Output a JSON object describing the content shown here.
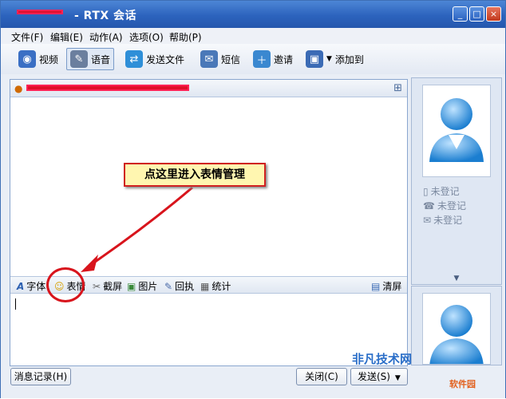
{
  "window": {
    "title": "- RTX 会话",
    "btn_min": "_",
    "btn_max": "□",
    "btn_close": "×"
  },
  "menu": [
    "文件(F)",
    "编辑(E)",
    "动作(A)",
    "选项(O)",
    "帮助(P)"
  ],
  "toolbar": {
    "video": "视频",
    "voice": "语音",
    "send_file": "发送文件",
    "sms": "短信",
    "invite": "邀请",
    "add_to": "添加到"
  },
  "format_bar": {
    "font": "字体",
    "emoticon": "表情",
    "screenshot": "截屏",
    "picture": "图片",
    "receipt": "回执",
    "stats": "统计",
    "clear": "清屏"
  },
  "annotation": {
    "callout": "点这里进入表情管理"
  },
  "side_panel": {
    "status1": "未登记",
    "status2": "未登记",
    "status3": "未登记"
  },
  "bottom": {
    "history": "消息记录(H)",
    "close": "关闭(C)",
    "send": "发送(S)"
  },
  "watermark": {
    "main": "非凡技术网",
    "sub": "软件园"
  },
  "colors": {
    "title_bar": "#2c63bd",
    "annotation_red": "#d8141c",
    "callout_bg": "#fff6b0"
  }
}
